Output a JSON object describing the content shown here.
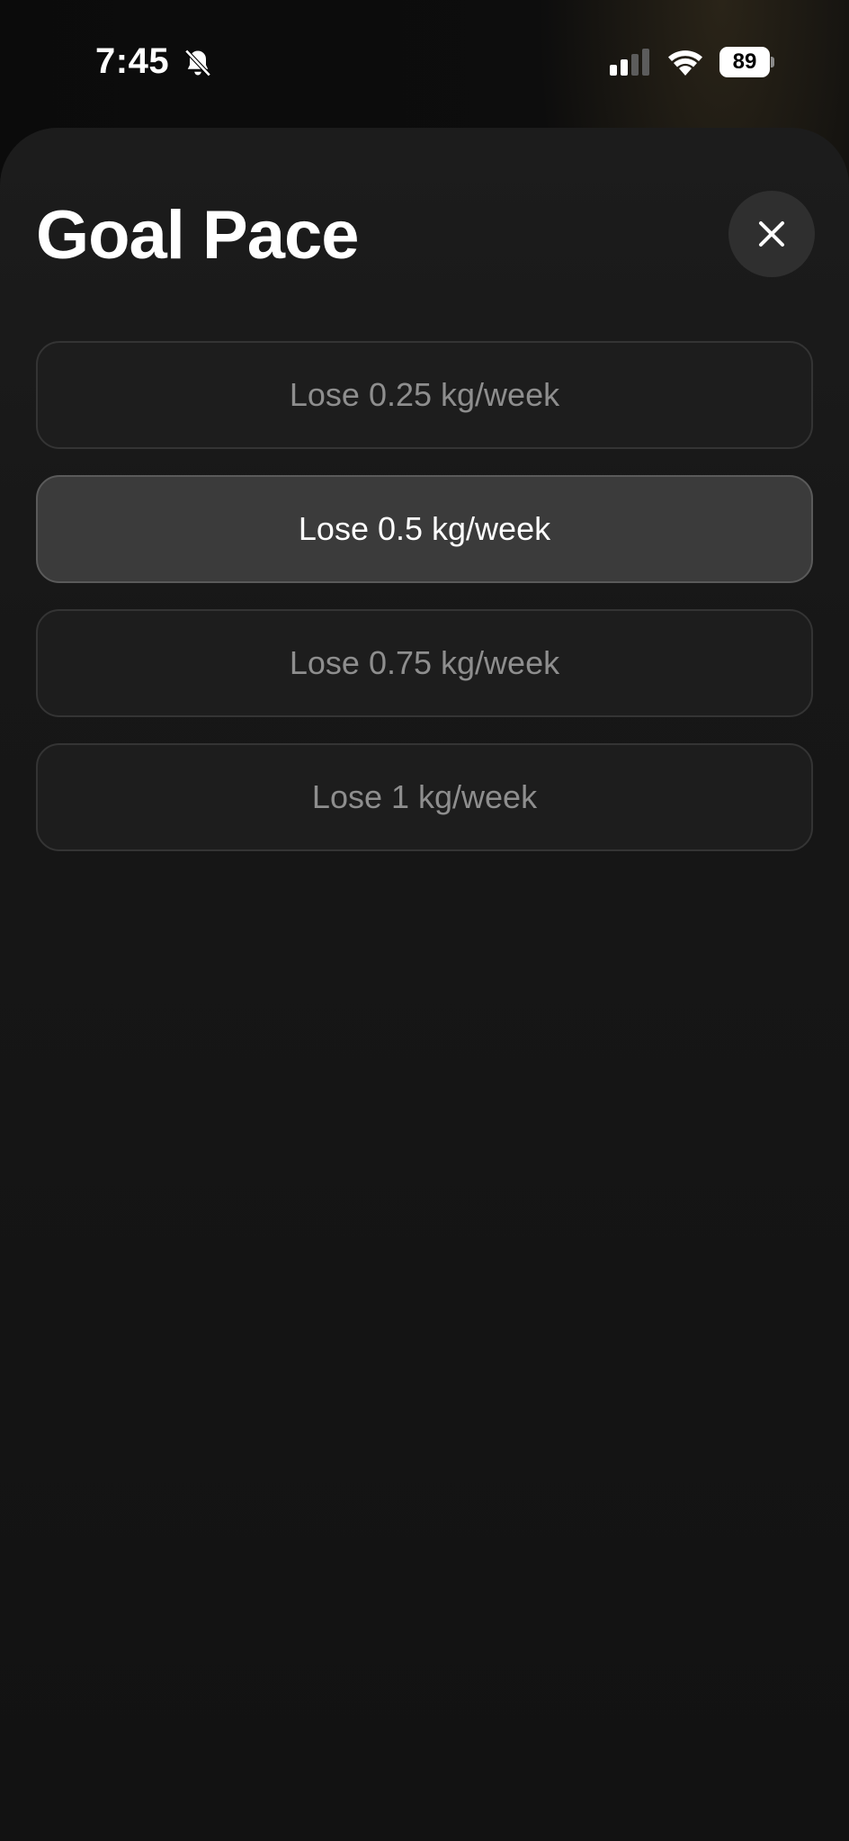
{
  "status_bar": {
    "time": "7:45",
    "battery_level": "89",
    "icons": [
      "bell-slash-icon",
      "cellular-signal-icon",
      "wifi-icon",
      "battery-icon"
    ]
  },
  "sheet": {
    "title": "Goal Pace",
    "close_icon": "close-icon",
    "options": [
      {
        "label": "Lose 0.25 kg/week",
        "selected": false
      },
      {
        "label": "Lose 0.5 kg/week",
        "selected": true
      },
      {
        "label": "Lose 0.75 kg/week",
        "selected": false
      },
      {
        "label": "Lose 1 kg/week",
        "selected": false
      }
    ]
  },
  "colors": {
    "background": "#0d0d0d",
    "sheet": "#1a1a1a",
    "option_bg": "#1d1d1d",
    "option_selected_bg": "#3b3b3b",
    "text_primary": "#ffffff",
    "text_muted": "#8e8e8e"
  }
}
